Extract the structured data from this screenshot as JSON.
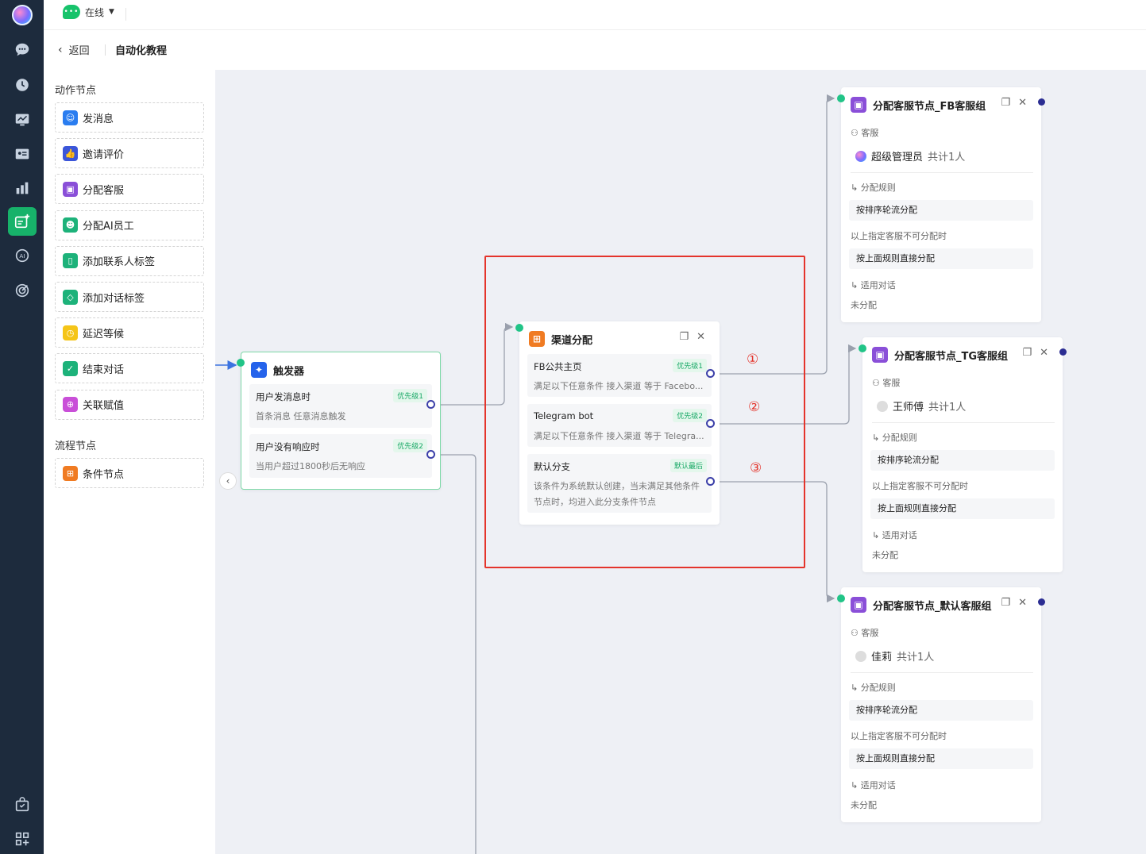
{
  "topbar": {
    "status_label": "在线"
  },
  "breadcrumb": {
    "back_label": "返回",
    "title": "自动化教程"
  },
  "palette": {
    "action_title": "动作节点",
    "action_items": [
      {
        "label": "发消息",
        "icon": "message-icon",
        "color": "#2a7df0"
      },
      {
        "label": "邀请评价",
        "icon": "thumbs-up-icon",
        "color": "#3b56d9"
      },
      {
        "label": "分配客服",
        "icon": "agent-card-icon",
        "color": "#8a4fd8"
      },
      {
        "label": "分配AI员工",
        "icon": "ai-agent-icon",
        "color": "#1db27a"
      },
      {
        "label": "添加联系人标签",
        "icon": "bookmark-icon",
        "color": "#1db27a"
      },
      {
        "label": "添加对话标签",
        "icon": "tag-icon",
        "color": "#1db27a"
      },
      {
        "label": "延迟等候",
        "icon": "clock-icon",
        "color": "#f5c518"
      },
      {
        "label": "结束对话",
        "icon": "check-icon",
        "color": "#1db27a"
      },
      {
        "label": "关联赋值",
        "icon": "link-icon",
        "color": "#c94fd8"
      }
    ],
    "flow_title": "流程节点",
    "flow_items": [
      {
        "label": "条件节点",
        "icon": "condition-icon",
        "color": "#f07b22"
      }
    ]
  },
  "trigger": {
    "title": "触发器",
    "rows": [
      {
        "title": "用户发消息时",
        "desc": "首条消息  任意消息触发",
        "badge": "优先级1"
      },
      {
        "title": "用户没有响应时",
        "desc": "当用户超过1800秒后无响应",
        "badge": "优先级2"
      }
    ]
  },
  "channel": {
    "title": "渠道分配",
    "rows": [
      {
        "title": "FB公共主页",
        "desc": "满足以下任意条件  接入渠道  等于  Facebo...",
        "badge": "优先级1"
      },
      {
        "title": "Telegram bot",
        "desc": "满足以下任意条件  接入渠道  等于  Telegra...",
        "badge": "优先级2"
      },
      {
        "title": "默认分支",
        "desc": "该条件为系统默认创建，当未满足其他条件",
        "desc2": "节点时，均进入此分支条件节点",
        "badge": "默认最后"
      }
    ]
  },
  "annotations": [
    "①",
    "②",
    "③"
  ],
  "assign_nodes": [
    {
      "title": "分配客服节点_FB客服组",
      "agent_label": "客服",
      "agent_name": "超级管理员",
      "agent_count": "共计1人",
      "rule_label": "分配规则",
      "rule": "按排序轮流分配",
      "fallback_note": "以上指定客服不可分配时",
      "fallback": "按上面规则直接分配",
      "apply_label": "适用对话",
      "apply_value": "未分配"
    },
    {
      "title": "分配客服节点_TG客服组",
      "agent_label": "客服",
      "agent_name": "王师傅",
      "agent_count": "共计1人",
      "rule_label": "分配规则",
      "rule": "按排序轮流分配",
      "fallback_note": "以上指定客服不可分配时",
      "fallback": "按上面规则直接分配",
      "apply_label": "适用对话",
      "apply_value": "未分配"
    },
    {
      "title": "分配客服节点_默认客服组",
      "agent_label": "客服",
      "agent_name": "佳莉",
      "agent_count": "共计1人",
      "rule_label": "分配规则",
      "rule": "按排序轮流分配",
      "fallback_note": "以上指定客服不可分配时",
      "fallback": "按上面规则直接分配",
      "apply_label": "适用对话",
      "apply_value": "未分配"
    }
  ],
  "colors": {
    "accent": "#17b26a",
    "nav_bg": "#1d2b3d",
    "annotation_red": "#e4342b",
    "port_blue": "#3b3fa8"
  }
}
